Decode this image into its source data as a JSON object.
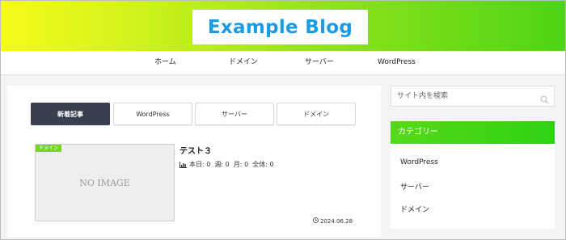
{
  "header": {
    "logo_text": "Example Blog"
  },
  "nav": {
    "items": [
      {
        "label": "ホーム"
      },
      {
        "label": "ドメイン"
      },
      {
        "label": "サーバー"
      },
      {
        "label": "WordPress"
      }
    ]
  },
  "main": {
    "tabs": [
      {
        "label": "新着記事",
        "active": true
      },
      {
        "label": "WordPress",
        "active": false
      },
      {
        "label": "サーバー",
        "active": false
      },
      {
        "label": "ドメイン",
        "active": false
      }
    ],
    "post": {
      "category_badge": "ドメイン",
      "thumbnail_text": "NO IMAGE",
      "title": "テスト３",
      "stats_text": "本日: 0  週: 0  月: 0  全体: 0",
      "date": "2024.06.28"
    }
  },
  "sidebar": {
    "search": {
      "placeholder": "サイト内を検索",
      "value": ""
    },
    "category_widget": {
      "title": "カテゴリー",
      "items": [
        {
          "label": "WordPress"
        },
        {
          "label": "サーバー"
        },
        {
          "label": "ドメイン"
        }
      ]
    }
  },
  "colors": {
    "header_gradient_start": "#f5fb1a",
    "header_gradient_end": "#4ed416",
    "logo_text": "#1a9be8",
    "active_tab_bg": "#3a3f50",
    "category_header_bg": "#2fd113",
    "category_badge_bg": "#7ad51e"
  },
  "icons": {
    "stats": "bar-chart-icon",
    "date": "clock-icon",
    "search": "search-icon"
  }
}
